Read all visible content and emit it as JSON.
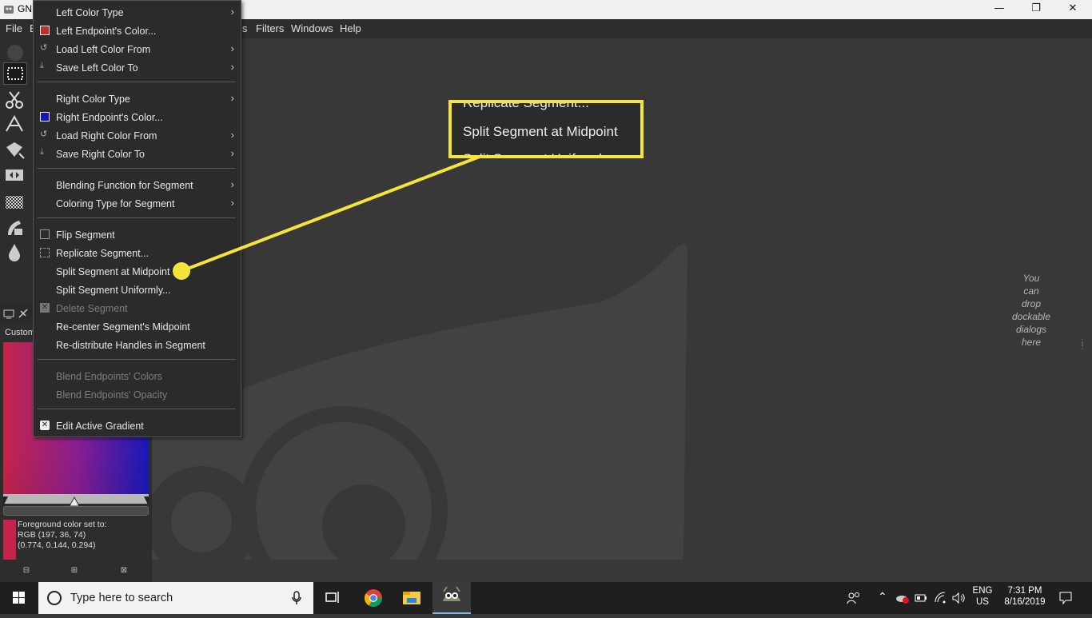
{
  "window": {
    "title": "GN",
    "controls": [
      "—",
      "❐",
      "✕"
    ]
  },
  "menubar": {
    "items": [
      "File",
      "E",
      "ls",
      "Filters",
      "Windows",
      "Help"
    ]
  },
  "context_menu": {
    "items": [
      {
        "label": "Left Color Type",
        "submenu": true
      },
      {
        "label": "Left Endpoint's Color...",
        "icon": "red-swatch-icon"
      },
      {
        "label": "Load Left Color From",
        "submenu": true,
        "icon": "undo-icon"
      },
      {
        "label": "Save Left Color To",
        "submenu": true,
        "icon": "save-icon"
      },
      {
        "label": "Right Color Type",
        "submenu": true
      },
      {
        "label": "Right Endpoint's Color...",
        "icon": "blue-swatch-icon"
      },
      {
        "label": "Load Right Color From",
        "submenu": true,
        "icon": "undo-icon"
      },
      {
        "label": "Save Right Color To",
        "submenu": true,
        "icon": "save-icon"
      },
      {
        "label": "Blending Function for Segment",
        "submenu": true
      },
      {
        "label": "Coloring Type for Segment",
        "submenu": true
      },
      {
        "label": "Flip Segment",
        "icon": "flip-icon"
      },
      {
        "label": "Replicate Segment...",
        "icon": "replicate-icon"
      },
      {
        "label": "Split Segment at Midpoint"
      },
      {
        "label": "Split Segment Uniformly..."
      },
      {
        "label": "Delete Segment",
        "disabled": true,
        "icon": "delete-icon"
      },
      {
        "label": "Re-center Segment's Midpoint"
      },
      {
        "label": "Re-distribute Handles in Segment"
      },
      {
        "label": "Blend Endpoints' Colors",
        "disabled": true
      },
      {
        "label": "Blend Endpoints' Opacity",
        "disabled": true
      },
      {
        "label": "Edit Active Gradient",
        "icon": "close-icon"
      }
    ]
  },
  "callout": {
    "top": "Replicate Segment...",
    "main": "Split Segment at Midpoint",
    "bottom": "Split Segment Uniformly..."
  },
  "dock": {
    "tab_label": "Custom",
    "foreground_line1": "Foreground color set to:",
    "foreground_line2": "RGB (197, 36, 74)",
    "foreground_line3": "(0.774, 0.144, 0.294)"
  },
  "canvas": {
    "dock_hint": [
      "You",
      "can",
      "drop",
      "dockable",
      "dialogs",
      "here"
    ]
  },
  "taskbar": {
    "search_placeholder": "Type here to search",
    "lang_top": "ENG",
    "lang_bottom": "US",
    "time": "7:31 PM",
    "date": "8/16/2019"
  },
  "colors": {
    "highlight": "#f5e43a",
    "fg_color": "#c5244a",
    "right_endpoint": "#1818b8",
    "left_endpoint": "#c0302a"
  }
}
